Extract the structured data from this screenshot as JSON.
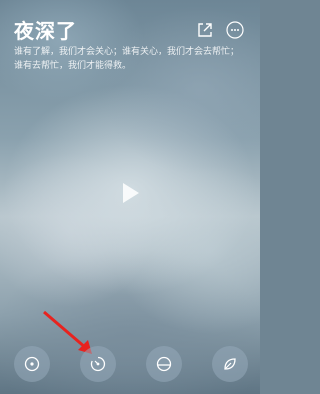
{
  "header": {
    "title": "夜深了",
    "quote": "谁有了解，我们才会关心；谁有关心，我们才会去帮忙；谁有去帮忙，我们才能得救。"
  },
  "icons": {
    "share": "share-icon",
    "more": "more-icon",
    "play": "play-icon",
    "focus": "target-icon",
    "timer": "timer-icon",
    "sunset": "sunset-icon",
    "leaf": "leaf-icon"
  },
  "colors": {
    "annotation_arrow": "#e8231f"
  }
}
